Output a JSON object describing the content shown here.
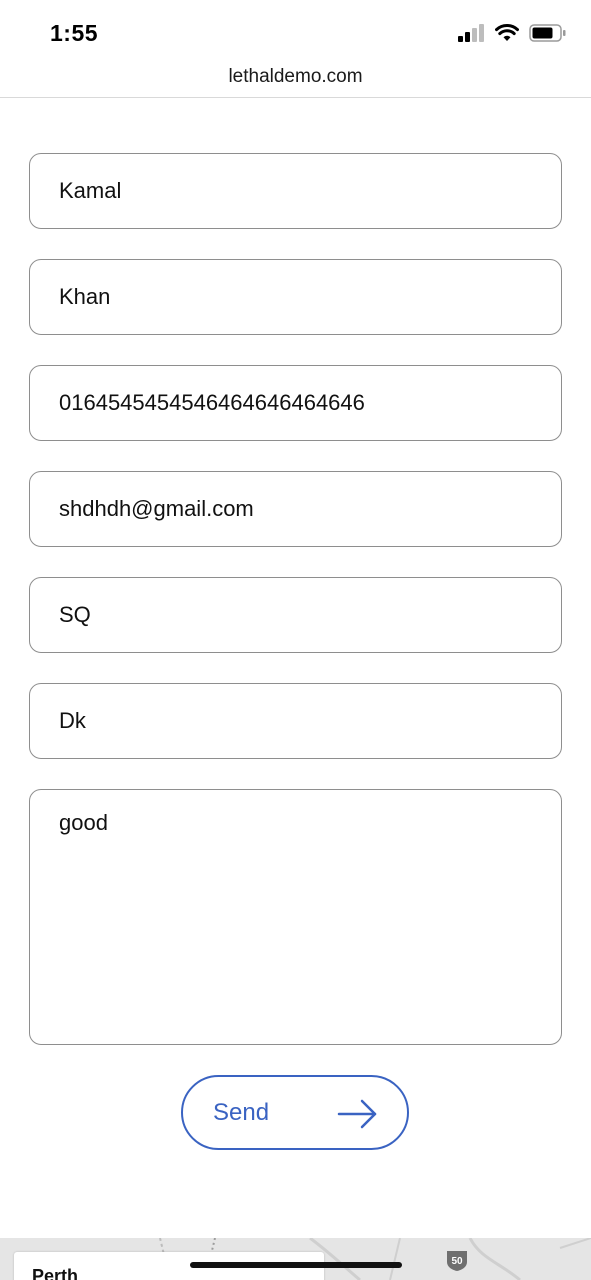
{
  "status_bar": {
    "time": "1:55",
    "icons": [
      "cellular-signal-icon",
      "wifi-icon",
      "battery-icon"
    ]
  },
  "browser": {
    "url": "lethaldemo.com"
  },
  "form": {
    "first_name": "Kamal",
    "last_name": "Khan",
    "phone": "0164545454546464646464646",
    "email": "shdhdh@gmail.com",
    "company": "SQ",
    "country": "Dk",
    "message": "good",
    "send_label": "Send"
  },
  "map": {
    "place_label": "Perth",
    "route_number": "50"
  },
  "colors": {
    "accent": "#3a63c2",
    "field_border": "#8e8e8e",
    "map_bg": "#e5e5e5"
  }
}
